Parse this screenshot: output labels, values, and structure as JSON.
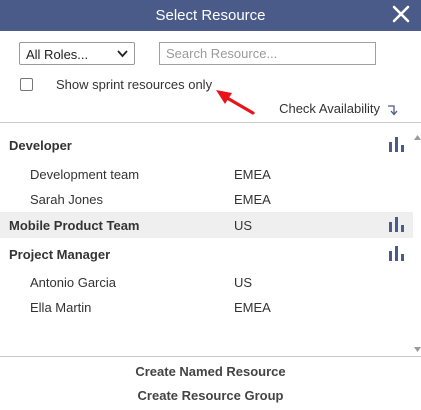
{
  "header": {
    "title": "Select Resource",
    "close_icon": "close-icon"
  },
  "filters": {
    "role_select": {
      "selected": "All Roles..."
    },
    "search": {
      "placeholder": "Search Resource..."
    },
    "sprint_only": {
      "label": "Show sprint resources only",
      "checked": false
    }
  },
  "availability": {
    "label": "Check Availability",
    "icon": "sort-down-icon"
  },
  "rows": [
    {
      "name": "Developer",
      "region": "",
      "type": "group",
      "chart_icon": true
    },
    {
      "name": "Development team",
      "region": "EMEA",
      "type": "member",
      "chart_icon": false
    },
    {
      "name": "Sarah Jones",
      "region": "EMEA",
      "type": "member",
      "chart_icon": false
    },
    {
      "name": "Mobile Product Team",
      "region": "US",
      "type": "group",
      "chart_icon": true,
      "highlighted": true
    },
    {
      "name": "Project Manager",
      "region": "",
      "type": "group",
      "chart_icon": true
    },
    {
      "name": "Antonio Garcia",
      "region": "US",
      "type": "member",
      "chart_icon": false
    },
    {
      "name": "Ella Martin",
      "region": "EMEA",
      "type": "member",
      "chart_icon": false
    }
  ],
  "footer": {
    "create_named": "Create Named Resource",
    "create_group": "Create Resource Group"
  },
  "colors": {
    "header_bg": "#4a5b8a",
    "accent": "#4a5b8a",
    "arrow": "#e8141b",
    "highlight": "#efefef"
  }
}
